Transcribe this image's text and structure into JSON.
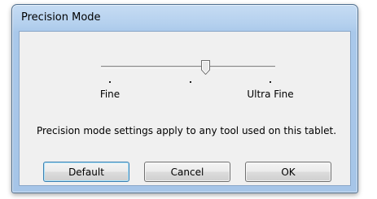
{
  "dialog": {
    "title": "Precision Mode"
  },
  "slider": {
    "level": 0.6,
    "labels": {
      "min": "Fine",
      "max": "Ultra Fine"
    }
  },
  "description": "Precision mode settings apply to any tool used on this tablet.",
  "buttons": {
    "default_label": "Default",
    "cancel_label": "Cancel",
    "ok_label": "OK"
  },
  "colors": {
    "title_bar": "#b4d0ee",
    "client_bg": "#f0f0f0",
    "focus_border": "#3c7fb1"
  }
}
